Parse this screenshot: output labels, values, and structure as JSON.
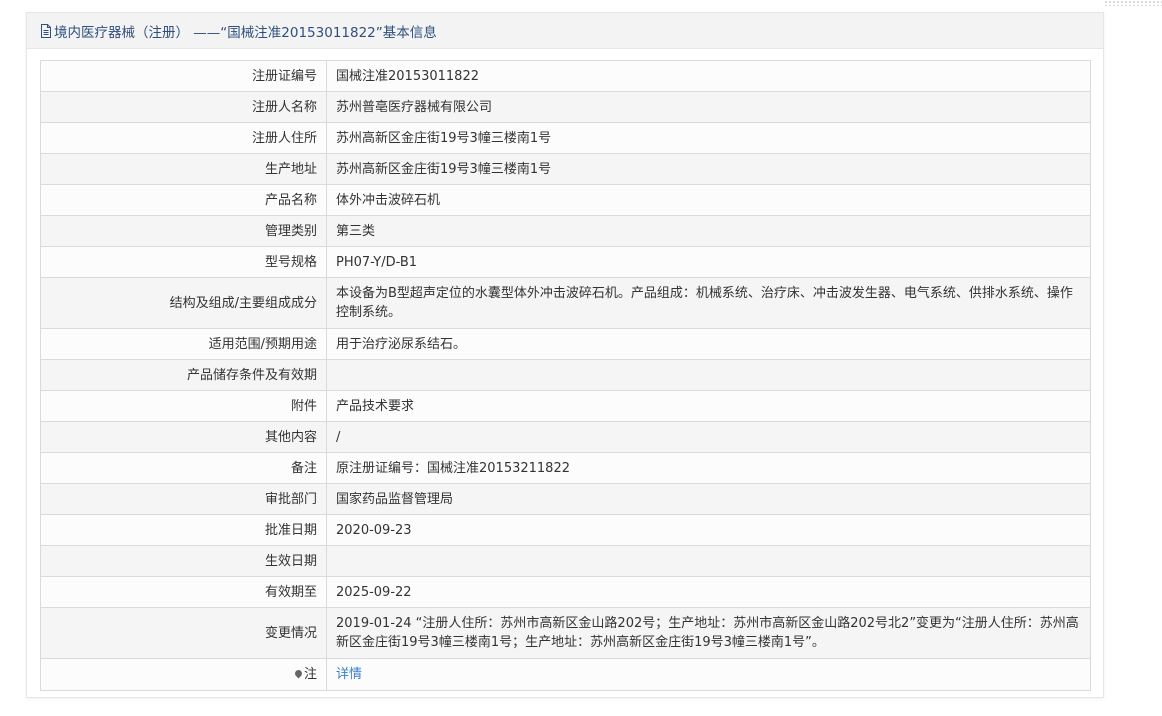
{
  "page": {
    "title": "境内医疗器械（注册） ——“国械注准20153011822”基本信息"
  },
  "rows": [
    {
      "label": "注册证编号",
      "value": "国械注准20153011822"
    },
    {
      "label": "注册人名称",
      "value": "苏州普亳医疗器械有限公司"
    },
    {
      "label": "注册人住所",
      "value": "苏州高新区金庄街19号3幢三楼南1号"
    },
    {
      "label": "生产地址",
      "value": "苏州高新区金庄街19号3幢三楼南1号"
    },
    {
      "label": "产品名称",
      "value": "体外冲击波碎石机"
    },
    {
      "label": "管理类别",
      "value": "第三类"
    },
    {
      "label": "型号规格",
      "value": "PH07-Y/D-B1"
    },
    {
      "label": "结构及组成/主要组成成分",
      "value": "本设备为B型超声定位的水囊型体外冲击波碎石机。产品组成：机械系统、治疗床、冲击波发生器、电气系统、供排水系统、操作控制系统。"
    },
    {
      "label": "适用范围/预期用途",
      "value": "用于治疗泌尿系结石。"
    },
    {
      "label": "产品储存条件及有效期",
      "value": ""
    },
    {
      "label": "附件",
      "value": "产品技术要求"
    },
    {
      "label": "其他内容",
      "value": "/"
    },
    {
      "label": "备注",
      "value": "原注册证编号：国械注准20153211822"
    },
    {
      "label": "审批部门",
      "value": "国家药品监督管理局"
    },
    {
      "label": "批准日期",
      "value": "2020-09-23"
    },
    {
      "label": "生效日期",
      "value": ""
    },
    {
      "label": "有效期至",
      "value": "2025-09-22"
    },
    {
      "label": "变更情况",
      "value": "2019-01-24 “注册人住所：苏州市高新区金山路202号；生产地址：苏州市高新区金山路202号北2”变更为“注册人住所：苏州高新区金庄街19号3幢三楼南1号；生产地址：苏州高新区金庄街19号3幢三楼南1号”。"
    }
  ],
  "note": {
    "label": "注",
    "link_text": "详情",
    "icon": "map-pin-icon"
  },
  "colors": {
    "title": "#2f4f7f",
    "link": "#3a7dc9",
    "border": "#dadada"
  }
}
